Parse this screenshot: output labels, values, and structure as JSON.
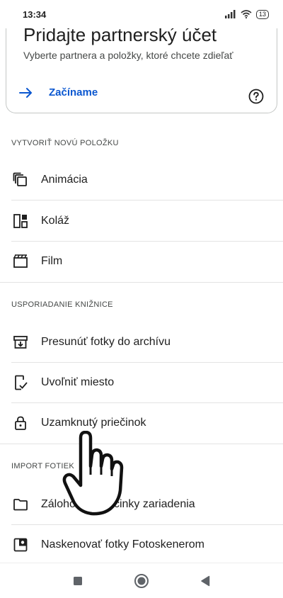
{
  "status": {
    "time": "13:34",
    "battery": "13"
  },
  "card": {
    "title": "Pridajte partnerský účet",
    "subtitle": "Vyberte partnera a položky, ktoré chcete zdieľať",
    "action_label": "Začíname"
  },
  "sections": {
    "create": "VYTVORIŤ NOVÚ POLOŽKU",
    "organize": "USPORIADANIE KNIŽNICE",
    "import": "IMPORT FOTIEK"
  },
  "create_items": [
    {
      "label": "Animácia",
      "icon": "animation-icon"
    },
    {
      "label": "Koláž",
      "icon": "collage-icon"
    },
    {
      "label": "Film",
      "icon": "film-icon"
    }
  ],
  "organize_items": [
    {
      "label": "Presunúť fotky do archívu",
      "icon": "archive-icon"
    },
    {
      "label": "Uvoľniť miesto",
      "icon": "free-space-icon"
    },
    {
      "label": "Uzamknutý priečinok",
      "icon": "lock-icon"
    }
  ],
  "import_items": [
    {
      "label": "Zálohovať priečinky zariadenia",
      "icon": "folder-icon"
    },
    {
      "label": "Naskenovať fotky Fotoskenerom",
      "icon": "photoscan-icon"
    }
  ]
}
